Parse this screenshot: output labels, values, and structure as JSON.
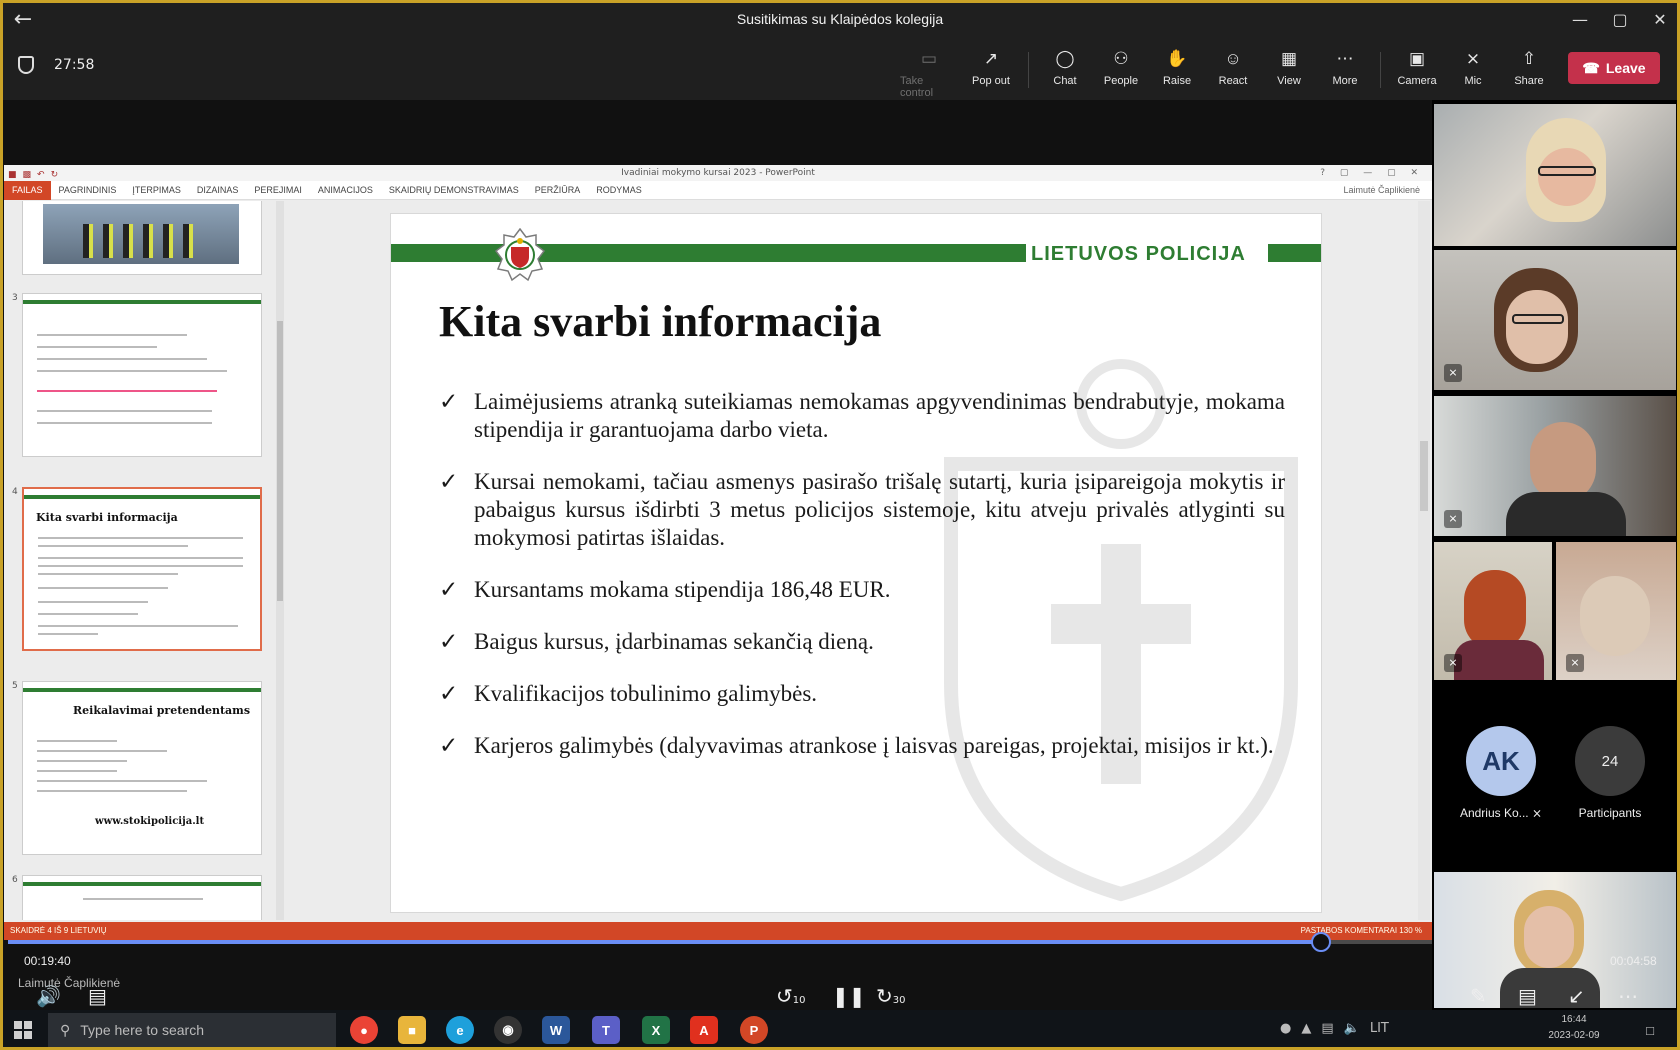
{
  "window": {
    "title": "Susitikimas su Klaipėdos kolegija",
    "back_icon": "arrow-left-icon"
  },
  "meeting": {
    "elapsed": "27:58",
    "buttons": [
      {
        "label": "Take control",
        "icon": "screen-icon",
        "enabled": false
      },
      {
        "label": "Pop out",
        "icon": "pop-out-icon"
      },
      {
        "label": "Chat",
        "icon": "chat-icon"
      },
      {
        "label": "People",
        "icon": "people-icon"
      },
      {
        "label": "Raise",
        "icon": "hand-icon"
      },
      {
        "label": "React",
        "icon": "smile-icon"
      },
      {
        "label": "View",
        "icon": "grid-icon"
      },
      {
        "label": "More",
        "icon": "ellipsis-icon"
      },
      {
        "label": "Camera",
        "icon": "camera-icon"
      },
      {
        "label": "Mic",
        "icon": "mic-off-icon"
      },
      {
        "label": "Share",
        "icon": "share-icon"
      }
    ],
    "leave_label": "Leave",
    "leave_color": "#c4314b"
  },
  "powerpoint": {
    "title": "Ivadiniai mokymo kursai 2023 - PowerPoint",
    "tabs": [
      "FAILAS",
      "PAGRINDINIS",
      "ĮTERPIMAS",
      "DIZAINAS",
      "PEREJIMAI",
      "ANIMACIJOS",
      "SKAIDRIŲ DEMONSTRAVIMAS",
      "PERŽIŪRA",
      "RODYMAS"
    ],
    "user": "Laimutė Čaplikienė",
    "status_left": "SKAIDRĖ 4 IŠ 9    LIETUVIŲ",
    "status_right": "PASTABOS   KOMENTARAI   130 %",
    "thumbnails": {
      "num3": "3",
      "num4": "4",
      "num5": "5",
      "num6": "6",
      "t4_title": "Kita svarbi informacija",
      "t5_title": "Reikalavimai pretendentams",
      "t5_link": "www.stokipolicija.lt"
    }
  },
  "slide": {
    "brand": "LIETUVOS POLICIJA",
    "brand_color": "#2e7d32",
    "title": "Kita svarbi informacija",
    "bullets": [
      "Laimėjusiems atranką suteikiamas nemokamas apgyvendinimas bendrabutyje, mokama stipendija ir garantuojama darbo vieta.",
      "Kursai nemokami, tačiau asmenys pasirašo trišalę sutartį, kuria įsipareigoja mokytis ir pabaigus kursus išdirbti 3 metus policijos sistemoje, kitu atveju privalės atlyginti su mokymosi patirtas išlaidas.",
      "Kursantams mokama stipendija 186,48 EUR.",
      "Baigus kursus, įdarbinamas sekančią dieną.",
      "Kvalifikacijos tobulinimo galimybės.",
      "Karjeros galimybės (dalyvavimas atrankose į laisvas pareigas, projektai, misijos ir kt.)."
    ]
  },
  "participants": {
    "avatar_initials": "AK",
    "avatar_name": "Andrius Ko...",
    "count": "24",
    "count_label": "Participants"
  },
  "playback": {
    "current": "00:19:40",
    "remaining": "00:04:58",
    "progress_fraction": 0.922,
    "presenter": "Laimutė Čaplikienė",
    "skip_back": "10",
    "skip_forward": "30"
  },
  "taskbar": {
    "search_placeholder": "Type here to search",
    "lang": "LIT",
    "time": "16:44",
    "date": "2023-02-09"
  }
}
